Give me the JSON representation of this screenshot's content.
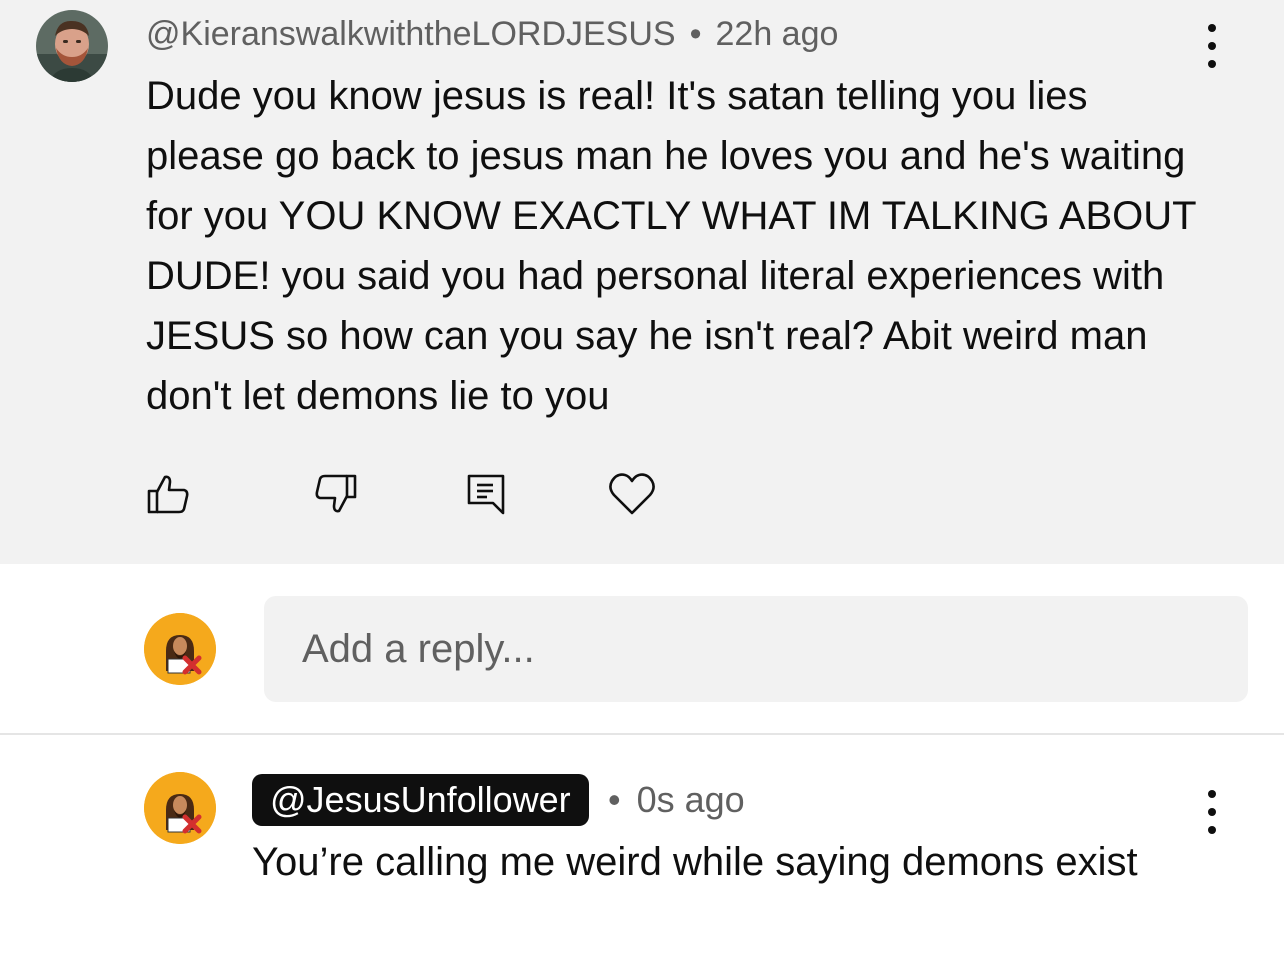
{
  "top_comment": {
    "author": "@KieranswalkwiththeLORDJESUS",
    "time": "22h ago",
    "separator": "•",
    "text": "Dude you know jesus is real! It's satan telling you lies please go back to jesus man he loves you and he's waiting for you YOU KNOW EXACTLY WHAT IM TALKING ABOUT DUDE! you said you had personal literal experiences with JESUS so how can you say he isn't real? Abit weird man don't let demons lie to you",
    "actions": [
      "like-icon",
      "dislike-icon",
      "reply-icon",
      "heart-icon"
    ],
    "more_icon": "more-vertical-icon"
  },
  "reply_box": {
    "placeholder": "Add a reply..."
  },
  "reply": {
    "author": "@JesusUnfollower",
    "separator": "•",
    "time": "0s ago",
    "text": "You’re calling me weird while saying demons exist",
    "more_icon": "more-vertical-icon"
  },
  "colors": {
    "comment_bg": "#f2f2f2",
    "meta_text": "#606060",
    "avatar_bg": "#f5a91c",
    "badge_bg": "#0f0f0f",
    "x_mark": "#d32f2f"
  }
}
